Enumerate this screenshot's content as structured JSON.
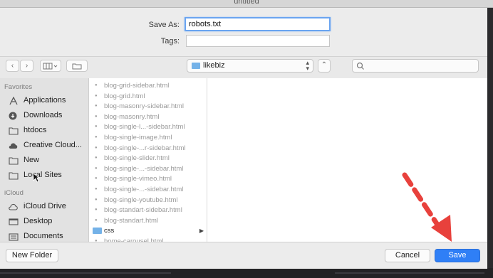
{
  "window": {
    "title": "untitled"
  },
  "save_form": {
    "save_as_label": "Save As:",
    "save_as_value": "robots.txt",
    "tags_label": "Tags:",
    "tags_value": ""
  },
  "toolbar": {
    "location": "likebiz"
  },
  "sidebar": {
    "favorites_header": "Favorites",
    "favorites": [
      {
        "label": "Applications",
        "icon": "applications-icon"
      },
      {
        "label": "Downloads",
        "icon": "downloads-icon"
      },
      {
        "label": "htdocs",
        "icon": "folder-icon"
      },
      {
        "label": "Creative Cloud...",
        "icon": "creative-cloud-icon"
      },
      {
        "label": "New",
        "icon": "folder-icon"
      },
      {
        "label": "Local Sites",
        "icon": "folder-icon"
      }
    ],
    "icloud_header": "iCloud",
    "icloud": [
      {
        "label": "iCloud Drive",
        "icon": "cloud-icon"
      },
      {
        "label": "Desktop",
        "icon": "desktop-icon"
      },
      {
        "label": "Documents",
        "icon": "documents-icon"
      }
    ]
  },
  "files": [
    {
      "name": "blog-grid-sidebar.html",
      "type": "file"
    },
    {
      "name": "blog-grid.html",
      "type": "file"
    },
    {
      "name": "blog-masonry-sidebar.html",
      "type": "file"
    },
    {
      "name": "blog-masonry.html",
      "type": "file"
    },
    {
      "name": "blog-single-l...-sidebar.html",
      "type": "file"
    },
    {
      "name": "blog-single-image.html",
      "type": "file"
    },
    {
      "name": "blog-single-...r-sidebar.html",
      "type": "file"
    },
    {
      "name": "blog-single-slider.html",
      "type": "file"
    },
    {
      "name": "blog-single-...-sidebar.html",
      "type": "file"
    },
    {
      "name": "blog-single-vimeo.html",
      "type": "file"
    },
    {
      "name": "blog-single-...-sidebar.html",
      "type": "file"
    },
    {
      "name": "blog-single-youtube.html",
      "type": "file"
    },
    {
      "name": "blog-standart-sidebar.html",
      "type": "file"
    },
    {
      "name": "blog-standart.html",
      "type": "file"
    },
    {
      "name": "css",
      "type": "folder"
    },
    {
      "name": "home-carousel.html",
      "type": "file"
    }
  ],
  "footer": {
    "new_folder_label": "New Folder",
    "cancel_label": "Cancel",
    "save_label": "Save"
  },
  "colors": {
    "primary_button": "#2f7ff6",
    "folder": "#74b2e8",
    "annotation_arrow": "#e8413c"
  }
}
